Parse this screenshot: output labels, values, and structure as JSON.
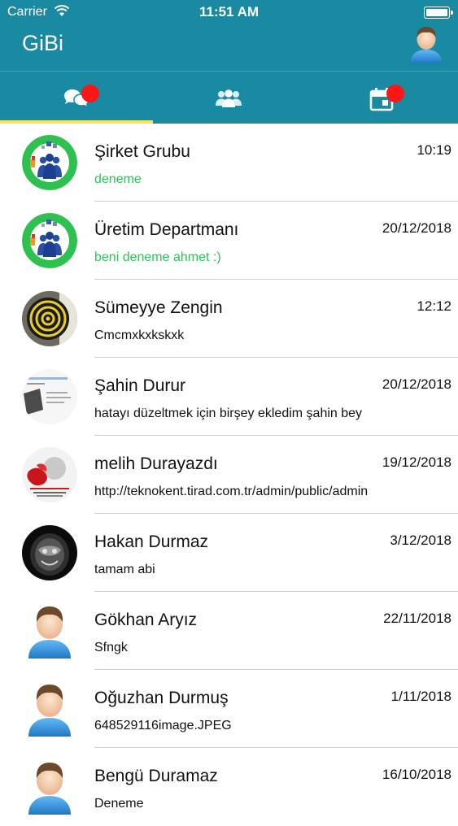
{
  "status_bar": {
    "carrier": "Carrier",
    "time": "11:51 AM"
  },
  "header": {
    "title": "GiBi"
  },
  "tabs": [
    {
      "icon": "chat-bubbles-icon",
      "badge": true,
      "active": true
    },
    {
      "icon": "people-icon",
      "badge": false,
      "active": false
    },
    {
      "icon": "calendar-icon",
      "badge": true,
      "active": false
    }
  ],
  "colors": {
    "header": "#1a8aa3",
    "indicator": "#f2e65b",
    "badge": "#ff1515",
    "group_message": "#2bc455"
  },
  "conversations": [
    {
      "name": "Şirket Grubu",
      "date": "10:19",
      "message": "deneme",
      "avatar": "group-logo-icon"
    },
    {
      "name": "Üretim Departmanı",
      "date": "20/12/2018",
      "message": "beni deneme ahmet :)",
      "avatar": "group-logo-icon"
    },
    {
      "name": "Sümeyye Zengin",
      "date": "12:12",
      "message": "Cmcmxkxkskxk",
      "avatar": "target-photo"
    },
    {
      "name": "Şahin Durur",
      "date": "20/12/2018",
      "message": "hatayı düzeltmek için birşey ekledim şahin bey",
      "avatar": "document-photo"
    },
    {
      "name": "melih Durayazdı",
      "date": "19/12/2018",
      "message": "http://teknokent.tirad.com.tr/admin/public/admin",
      "avatar": "poster-photo"
    },
    {
      "name": "Hakan Durmaz",
      "date": "3/12/2018",
      "message": "tamam abi",
      "avatar": "scan-photo"
    },
    {
      "name": "Gökhan Aryız",
      "date": "22/11/2018",
      "message": "Sfngk",
      "avatar": "default-user-icon"
    },
    {
      "name": "Oğuzhan Durmuş",
      "date": "1/11/2018",
      "message": "648529116image.JPEG",
      "avatar": "default-user-icon"
    },
    {
      "name": "Bengü Duramaz",
      "date": "16/10/2018",
      "message": "Deneme",
      "avatar": "default-user-icon"
    }
  ]
}
